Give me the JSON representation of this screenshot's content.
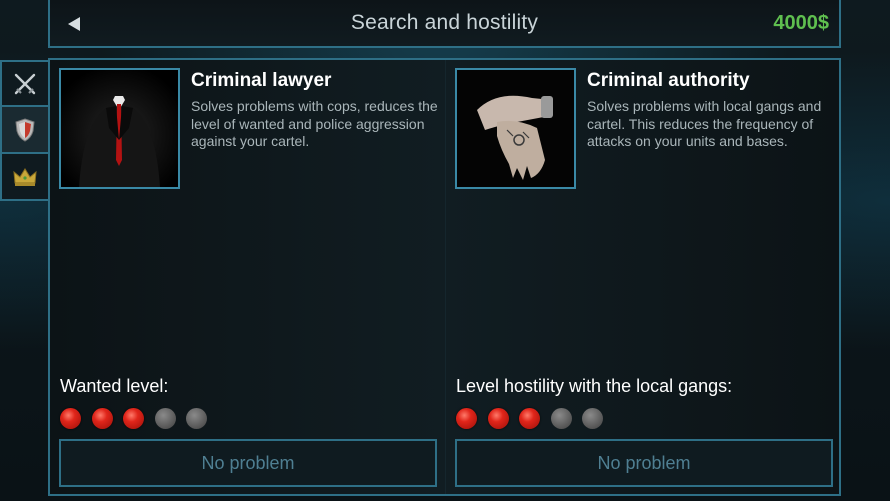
{
  "header": {
    "title": "Search and hostility",
    "money": "4000$"
  },
  "sidebar": {
    "tabs": [
      {
        "icon": "crossed-swords-icon",
        "active": false
      },
      {
        "icon": "shield-icon",
        "active": true
      },
      {
        "icon": "crown-icon",
        "active": false
      }
    ]
  },
  "cards": [
    {
      "title": "Criminal lawyer",
      "description": "Solves problems with cops, reduces the level of wanted and police aggression against your cartel.",
      "image": "suit-man-portrait",
      "level_label": "Wanted level:",
      "level": 3,
      "level_max": 5,
      "status": "No problem"
    },
    {
      "title": "Criminal authority",
      "description": "Solves problems with local gangs and cartel. This reduces the frequency of attacks on your units and bases.",
      "image": "tattooed-hands-portrait",
      "level_label": "Level hostility with the local gangs:",
      "level": 3,
      "level_max": 5,
      "status": "No problem"
    }
  ],
  "colors": {
    "accent_border": "#2e6f86",
    "money": "#5fbf4f",
    "level_on": "#e0251a",
    "level_off": "#5c5c5c",
    "status_text": "#4f7f92"
  }
}
